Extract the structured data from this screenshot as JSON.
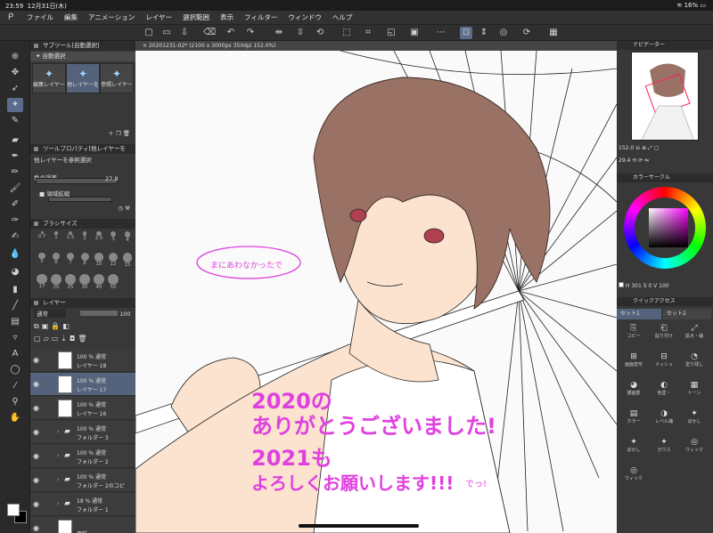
{
  "status": {
    "time": "23:59",
    "date": "12月31日(木)",
    "battery": "16%"
  },
  "menu": [
    "ファイル",
    "編集",
    "アニメーション",
    "レイヤー",
    "選択範囲",
    "表示",
    "フィルター",
    "ウィンドウ",
    "ヘルプ"
  ],
  "subtool": {
    "title": "サブツール[自動選択]",
    "group": "自動選択",
    "tabs": [
      "編集レイヤー",
      "他レイヤーを",
      "参照レイヤー"
    ]
  },
  "toolprop": {
    "title": "ツールプロパティ[他レイヤーを",
    "name": "他レイヤーを参照選択",
    "gap_label": "色の誤差",
    "gap_value": "27.8",
    "expand_label": "領域拡縮"
  },
  "brushsize": {
    "title": "ブラシサイズ",
    "sizes": [
      "0.7",
      "1",
      "1.5",
      "2",
      "2.5",
      "3",
      "4",
      "5",
      "6",
      "7",
      "8",
      "10",
      "12",
      "15",
      "17",
      "20",
      "25",
      "30",
      "40",
      "50"
    ]
  },
  "layers": {
    "title": "レイヤー",
    "blend": "通常",
    "opacity": "100",
    "items": [
      {
        "pct": "100 % 通常",
        "name": "レイヤー 18",
        "kind": "layer",
        "active": false
      },
      {
        "pct": "100 % 通常",
        "name": "レイヤー 17",
        "kind": "layer",
        "active": true
      },
      {
        "pct": "100 % 通常",
        "name": "レイヤー 16",
        "kind": "layer",
        "active": false
      },
      {
        "pct": "100 % 通常",
        "name": "フォルダー 3",
        "kind": "folder",
        "active": false
      },
      {
        "pct": "100 % 通常",
        "name": "フォルダー 2",
        "kind": "folder",
        "active": false
      },
      {
        "pct": "100 % 通常",
        "name": "フォルダー 2のコピ",
        "kind": "folder",
        "active": false
      },
      {
        "pct": "18 % 通常",
        "name": "フォルダー 1",
        "kind": "folder",
        "active": false
      },
      {
        "pct": "",
        "name": "用紙",
        "kind": "paper",
        "active": false
      }
    ]
  },
  "canvas": {
    "tab": "20201231-02* (2100 x 3000px 350dpi 152.0%)",
    "bubble_text": "まにあわなかったで",
    "message_line1": "2020の",
    "message_line2": "ありがとうございました!",
    "message_line3": "2021も",
    "message_line4": "よろしくお願いします!!!",
    "message_small": "でっ!"
  },
  "navigator": {
    "title": "ナビゲーター",
    "zoom": "152.0",
    "angle": "29.4"
  },
  "colorcircle": {
    "title": "カラーサークル",
    "h": "301",
    "s": "0",
    "v": "100",
    "accent": "#e040e0"
  },
  "quickaccess": {
    "title": "クイックアクセス",
    "tabs": [
      "セット1",
      "セット2"
    ],
    "items": [
      "コピー",
      "貼り付け",
      "拡大・縮",
      "画面変形",
      "メッシュ",
      "塗り残し",
      "描画部",
      "色塗・",
      "トーン",
      "カラー",
      "レベル補",
      "ぼかし",
      "ぼかし",
      "ガウス",
      "ウィック",
      "ウィック"
    ]
  }
}
